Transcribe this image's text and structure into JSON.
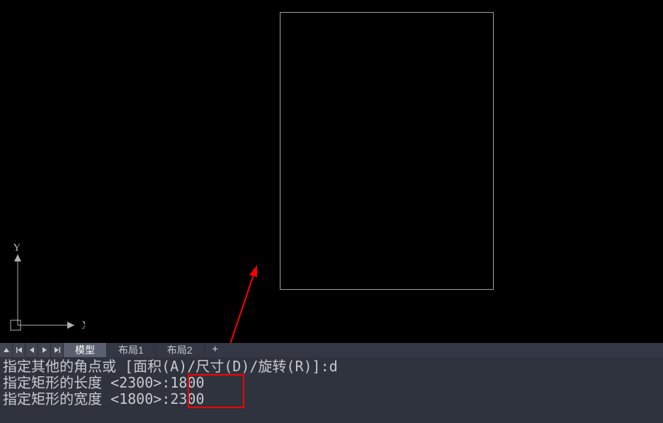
{
  "ucs": {
    "x_label": "X",
    "y_label": "Y"
  },
  "tabs": {
    "model": "模型",
    "layout1": "布局1",
    "layout2": "布局2",
    "add": "+"
  },
  "command": {
    "line1_prompt": "指定其他的角点或 [面积(A)/尺寸(D)/旋转(R)]: ",
    "line1_value": "d",
    "line2_prompt": "指定矩形的长度 <2300>: ",
    "line2_value": "1800",
    "line3_prompt": "指定矩形的宽度 <1800>: ",
    "line3_value": "2300"
  }
}
